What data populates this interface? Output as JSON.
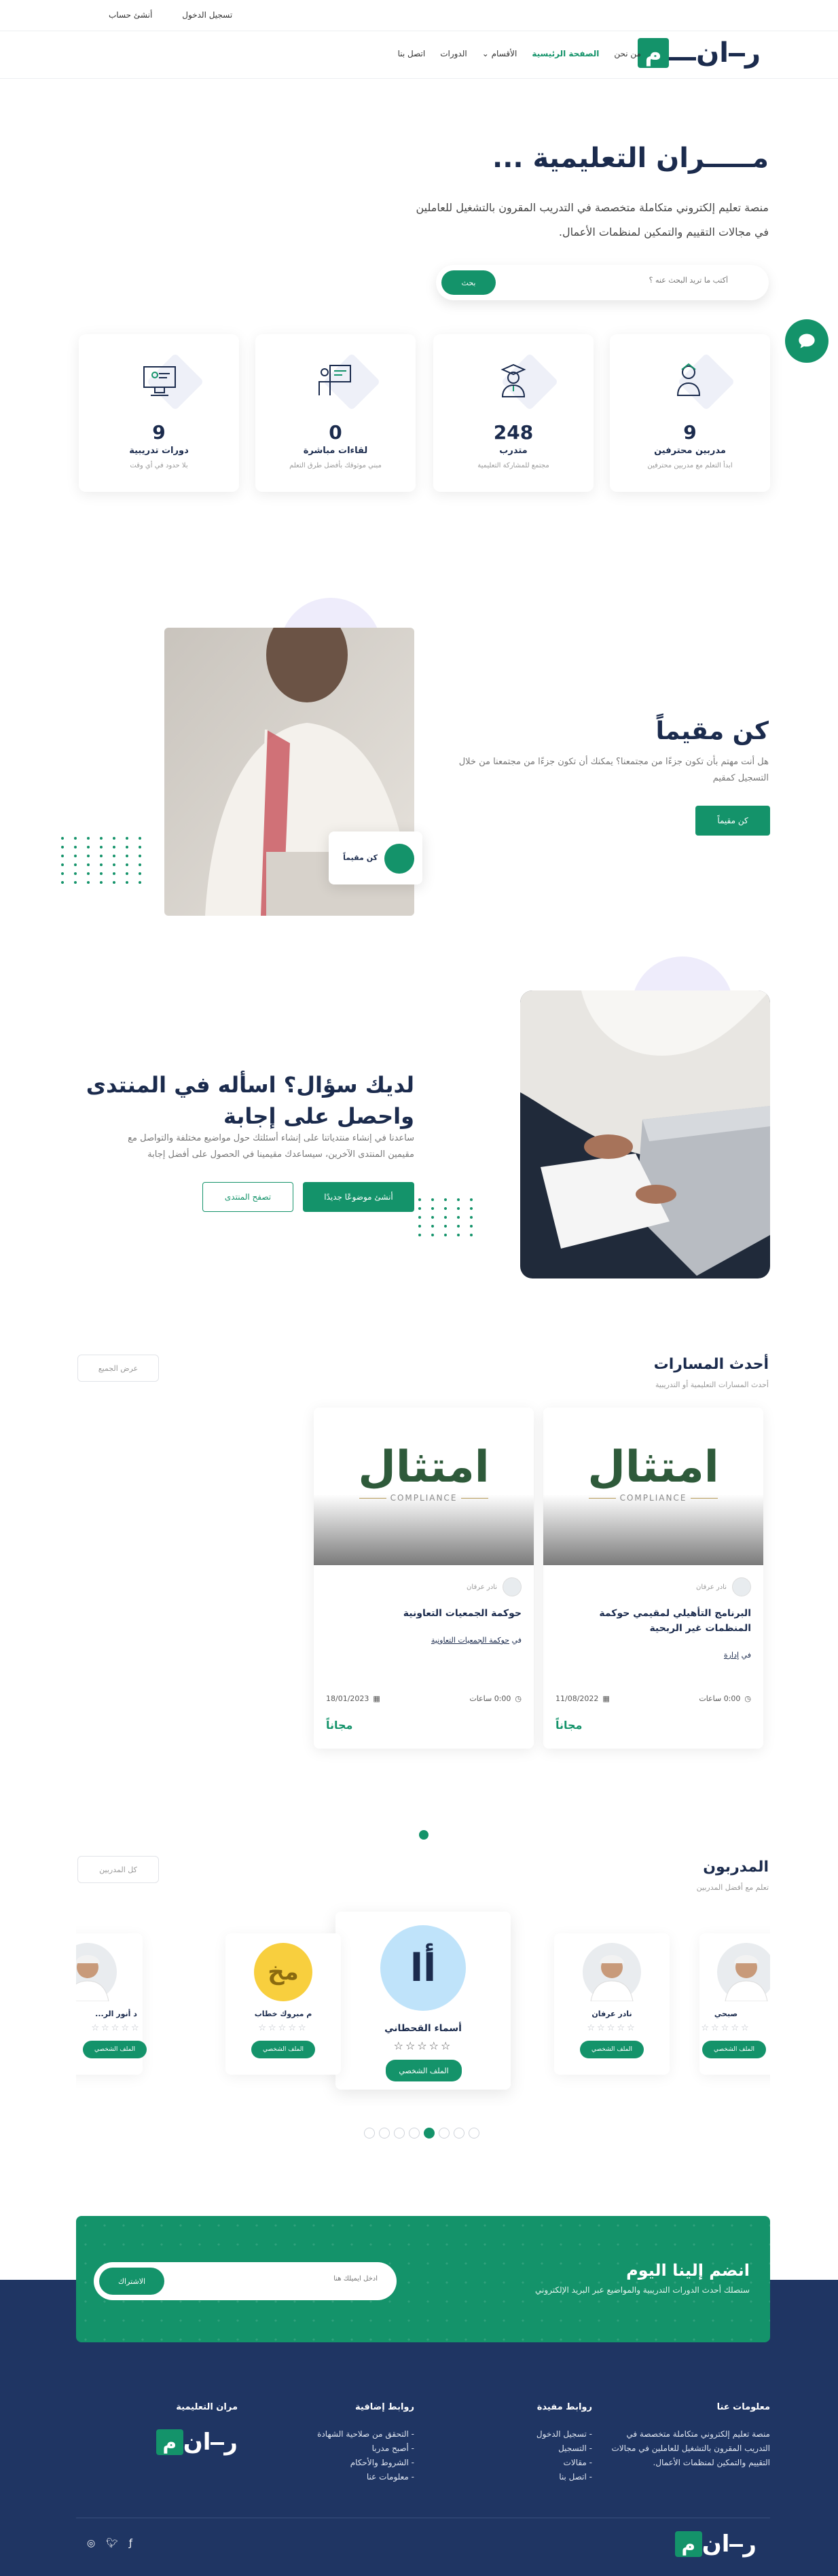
{
  "topbar": {
    "register": "تسجيل الدخول",
    "create_account": "أنشئ حساب"
  },
  "nav": {
    "items": [
      "من نحن",
      "الصفحة الرئيسية",
      "الأقسام",
      "الدورات",
      "اتصل بنا"
    ],
    "active": "الصفحة الرئيسية"
  },
  "logo": {
    "text": "مران",
    "tile_letter": "م"
  },
  "hero": {
    "title": "مـــــران التعليمية ...",
    "description": "منصة تعليم إلكتروني متكاملة متخصصة في التدريب المقرون بالتشغيل للعاملين في مجالات التقييم والتمكين لمنظمات الأعمال.",
    "search_placeholder": "أكتب ما تريد البحث عنه ؟",
    "search_button": "بحث"
  },
  "stats": [
    {
      "num": "9",
      "label": "مدربين محترفين",
      "sub": "ابدأ التعلم مع مدربين محترفين"
    },
    {
      "num": "248",
      "label": "متدرب",
      "sub": "مجتمع للمشاركة التعليمية"
    },
    {
      "num": "0",
      "label": "لقاءات مباشرة",
      "sub": "مبني موثوقك بأفضل طرق التعلم"
    },
    {
      "num": "9",
      "label": "دورات تدريبية",
      "sub": "بلا حدود في أي وقت"
    }
  ],
  "resident": {
    "title": "كن مقيماً",
    "description": "هل أنت مهتم بأن تكون جزءًا من مجتمعنا؟ يمكنك أن تكون جزءًا من مجتمعنا من خلال التسجيل كمقيم",
    "button": "كن مقيماً",
    "badge": "كن مقيماً"
  },
  "forum": {
    "title": "لديك سؤال؟ اسأله في المنتدى واحصل على إجابة",
    "description": "ساعدنا في إنشاء منتدياتنا على إنشاء أسئلتك حول مواضيع مختلفة والتواصل مع مقيمين المنتدى الآخرين، سيساعدك مقيمينا في الحصول على أفضل إجابة",
    "new_topic_button": "أنشئ موضوعًا جديدًا",
    "browse_button": "تصفح المنتدى"
  },
  "courses": {
    "title": "أحدث المسارات",
    "subtitle": "أحدث المسارات التعليمية أو التدريبية",
    "view_all": "عرض الجميع",
    "items": [
      {
        "brand": "امتثال",
        "brand_sub": "COMPLIANCE",
        "author": "نادر عرفان",
        "title": "البرنامج التأهيلي لمقيمي حوكمة المنظمات غير الربحية",
        "category_prefix": "في",
        "category": "إدارة",
        "hours": "0:00 ساعات",
        "date": "11/08/2022",
        "price": "مجاناً"
      },
      {
        "brand": "امتثال",
        "brand_sub": "COMPLIANCE",
        "author": "نادر عرفان",
        "title": "حوكمة الجمعيات التعاونية",
        "category_prefix": "في",
        "category": "حوكمة الجمعيات التعاونية",
        "hours": "0:00 ساعات",
        "date": "18/01/2023",
        "price": "مجاناً"
      }
    ]
  },
  "instructors": {
    "title": "المدربون",
    "subtitle": "تعلم مع أفضل المدربين",
    "view_all": "كل المدربين",
    "items": [
      {
        "name": "صبحي",
        "initials": "",
        "type": "photo"
      },
      {
        "name": "نادر عرفان",
        "initials": "",
        "type": "photo"
      },
      {
        "name": "أسماء القحطاني",
        "initials": "أا",
        "type": "initial",
        "color": "#bfe3fa"
      },
      {
        "name": "م مبروك خطاب",
        "initials": "مخ",
        "type": "initial",
        "color": "#f8cf3e"
      },
      {
        "name": "د أنور الر...",
        "initials": "",
        "type": "photo"
      }
    ],
    "profile_button": "الملف الشخصي",
    "stars": "☆☆☆☆☆"
  },
  "newsletter": {
    "title": "انضم إلينا اليوم",
    "subtitle": "ستصلك أحدث الدورات التدريبية والمواضيع عبر البريد الإلكتروني",
    "placeholder": "ادخل ايميلك هنا",
    "button": "الاشتراك"
  },
  "footer": {
    "about_title": "معلومات عنا",
    "about_text": "منصة تعليم إلكتروني متكاملة متخصصة في التدريب المقرون بالتشغيل للعاملين في مجالات التقييم والتمكين لمنظمات الأعمال.",
    "useful_title": "روابط مفيدة",
    "useful_links": [
      "- تسجيل الدخول",
      "- التسجيل",
      "- مقالات",
      "- اتصل بنا"
    ],
    "extra_title": "روابط إضافية",
    "extra_links": [
      "- التحقق من صلاحية الشهادة",
      "- أصبح مدربا",
      "- الشروط والأحكام",
      "- معلومات عنا"
    ],
    "brand_title": "مران التعليمية"
  },
  "colors": {
    "accent": "#14936a",
    "navy": "#1f3563"
  }
}
